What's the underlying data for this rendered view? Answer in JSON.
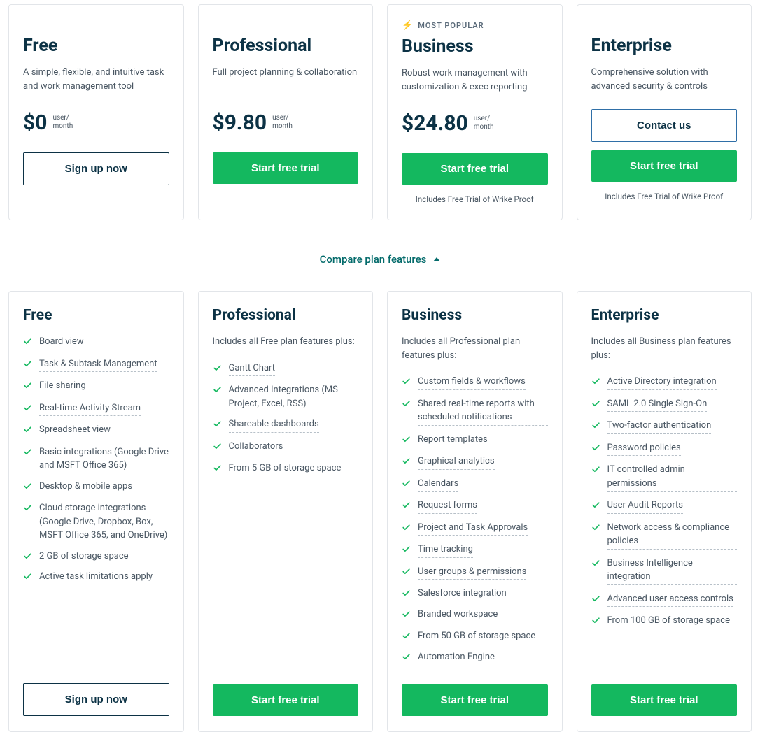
{
  "popular_label": "MOST POPULAR",
  "compare_label": "Compare plan features",
  "unit_top": "user/",
  "unit_bottom": "month",
  "plans": [
    {
      "name": "Free",
      "desc": "A simple, flexible, and intuitive task and work management tool",
      "price": "$0",
      "cta": "Sign up now",
      "cta_style": "outline",
      "popular": false,
      "contact": null,
      "trial_note": null
    },
    {
      "name": "Professional",
      "desc": "Full project planning & collaboration",
      "price": "$9.80",
      "cta": "Start free trial",
      "cta_style": "green",
      "popular": false,
      "contact": null,
      "trial_note": null
    },
    {
      "name": "Business",
      "desc": "Robust work management with customization & exec reporting",
      "price": "$24.80",
      "cta": "Start free trial",
      "cta_style": "green",
      "popular": true,
      "contact": null,
      "trial_note": "Includes Free Trial of Wrike Proof"
    },
    {
      "name": "Enterprise",
      "desc": "Comprehensive solution with advanced security & controls",
      "price": null,
      "cta": "Start free trial",
      "cta_style": "green",
      "popular": false,
      "contact": "Contact us",
      "trial_note": "Includes Free Trial of Wrike Proof"
    }
  ],
  "feature_cards": [
    {
      "name": "Free",
      "includes": null,
      "cta": "Sign up now",
      "cta_style": "outline",
      "features": [
        {
          "t": "Board view",
          "d": true
        },
        {
          "t": "Task & Subtask Management",
          "d": true
        },
        {
          "t": "File sharing",
          "d": true
        },
        {
          "t": "Real-time Activity Stream",
          "d": true
        },
        {
          "t": "Spreadsheet view",
          "d": true
        },
        {
          "t": "Basic integrations (Google Drive and MSFT Office 365)",
          "d": false
        },
        {
          "t": "Desktop & mobile apps",
          "d": true
        },
        {
          "t": "Cloud storage integrations (Google Drive, Dropbox, Box, MSFT Office 365, and OneDrive)",
          "d": false
        },
        {
          "t": "2 GB of storage space",
          "d": false
        },
        {
          "t": "Active task limitations apply",
          "d": false
        }
      ]
    },
    {
      "name": "Professional",
      "includes": "Includes all Free plan features plus:",
      "cta": "Start free trial",
      "cta_style": "green",
      "features": [
        {
          "t": "Gantt Chart",
          "d": true
        },
        {
          "t": "Advanced Integrations (MS Project, Excel, RSS)",
          "d": false
        },
        {
          "t": "Shareable dashboards",
          "d": true
        },
        {
          "t": "Collaborators",
          "d": true
        },
        {
          "t": "From 5 GB of storage space",
          "d": false
        }
      ]
    },
    {
      "name": "Business",
      "includes": "Includes all Professional plan features plus:",
      "cta": "Start free trial",
      "cta_style": "green",
      "features": [
        {
          "t": "Custom fields & workflows",
          "d": true
        },
        {
          "t": "Shared real-time reports with scheduled notifications",
          "d": true
        },
        {
          "t": "Report templates",
          "d": true
        },
        {
          "t": "Graphical analytics",
          "d": true
        },
        {
          "t": "Calendars",
          "d": true
        },
        {
          "t": "Request forms",
          "d": true
        },
        {
          "t": "Project and Task Approvals",
          "d": true
        },
        {
          "t": "Time tracking",
          "d": true
        },
        {
          "t": "User groups & permissions",
          "d": true
        },
        {
          "t": "Salesforce integration",
          "d": false
        },
        {
          "t": "Branded workspace",
          "d": true
        },
        {
          "t": "From 50 GB of storage space",
          "d": false
        },
        {
          "t": "Automation Engine",
          "d": false
        }
      ]
    },
    {
      "name": "Enterprise",
      "includes": "Includes all Business plan features plus:",
      "cta": "Start free trial",
      "cta_style": "green",
      "features": [
        {
          "t": "Active Directory integration",
          "d": true
        },
        {
          "t": "SAML 2.0 Single Sign-On",
          "d": true
        },
        {
          "t": "Two-factor authentication",
          "d": true
        },
        {
          "t": "Password policies",
          "d": true
        },
        {
          "t": "IT controlled admin permissions",
          "d": true
        },
        {
          "t": "User Audit Reports",
          "d": true
        },
        {
          "t": "Network access & compliance policies",
          "d": true
        },
        {
          "t": "Business Intelligence integration",
          "d": true
        },
        {
          "t": "Advanced user access controls",
          "d": true
        },
        {
          "t": "From 100 GB of storage space",
          "d": false
        }
      ]
    }
  ]
}
